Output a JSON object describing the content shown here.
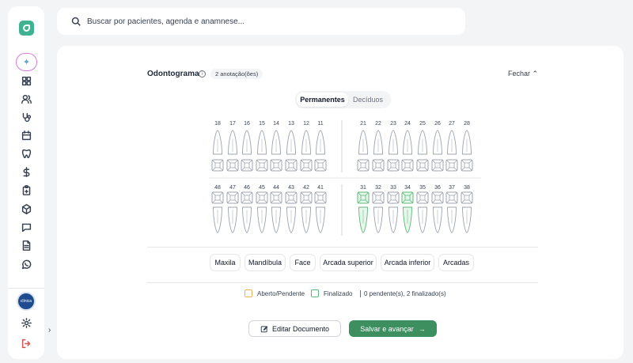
{
  "search": {
    "placeholder": "Buscar por pacientes, agenda e anamnese..."
  },
  "sidebar": {
    "icons": [
      "dashboard-icon",
      "users-icon",
      "stethoscope-icon",
      "calendar-icon",
      "tooth-icon",
      "dollar-icon",
      "clipboard-icon",
      "box-icon",
      "message-icon",
      "document-icon",
      "whatsapp-icon"
    ],
    "bottom_icons": [
      "settings-icon",
      "logout-icon"
    ],
    "avatar_text": "clínica"
  },
  "odontogram": {
    "title": "Odontograma",
    "annotations_badge": "2 anotação(ões)",
    "close_label": "Fechar",
    "tabs": {
      "permanent": "Permanentes",
      "deciduous": "Decíduos"
    },
    "upper_right": [
      "18",
      "17",
      "16",
      "15",
      "14",
      "13",
      "12",
      "11"
    ],
    "upper_left": [
      "21",
      "22",
      "23",
      "24",
      "25",
      "26",
      "27",
      "28"
    ],
    "lower_right": [
      "48",
      "47",
      "46",
      "45",
      "44",
      "43",
      "42",
      "41"
    ],
    "lower_left": [
      "31",
      "32",
      "33",
      "34",
      "35",
      "36",
      "37",
      "38"
    ],
    "finalized_teeth": [
      "31",
      "34"
    ],
    "region_buttons": [
      "Maxila",
      "Mandíbula",
      "Face",
      "Arcada superior",
      "Arcada inferior",
      "Arcadas"
    ],
    "legend": {
      "pending": "Aberto/Pendente",
      "finalized": "Finalizado"
    },
    "summary": "0 pendente(s), 2 finalizado(s)",
    "colors": {
      "pending": "#f0b35a",
      "finalized": "#5cb87a",
      "tooth_outline": "#9ca3af",
      "primary": "#3d8f5f"
    }
  },
  "actions": {
    "edit_label": "Editar Documento",
    "save_label": "Salvar e avançar"
  }
}
